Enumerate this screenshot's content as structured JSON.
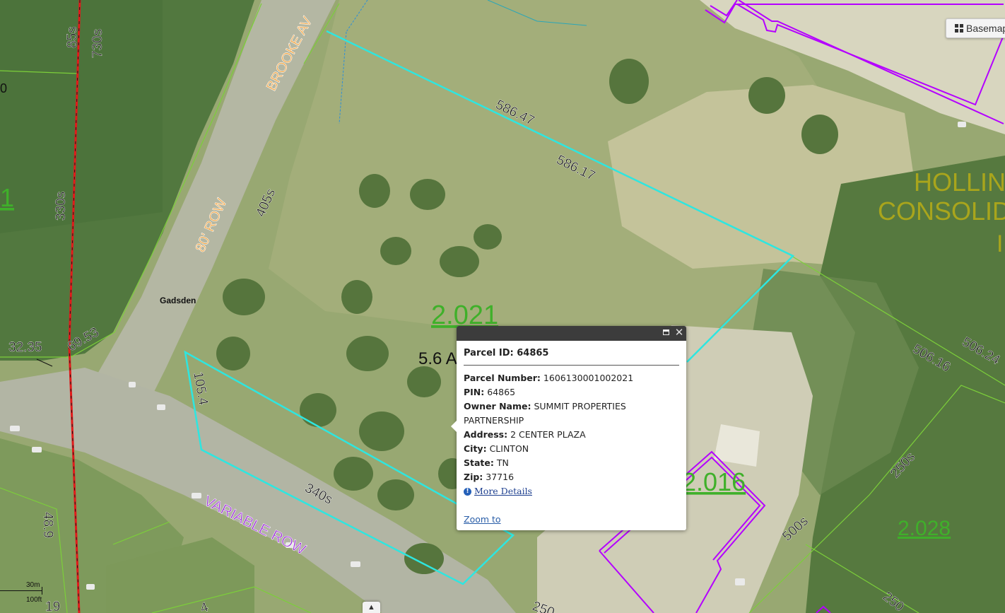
{
  "basemap": {
    "label": "Basemap",
    "icon": "grid-icon"
  },
  "map_labels": {
    "street_brooke": "BROOKE AV",
    "row_80": "80' ROW",
    "variable_row": "VARIABLE ROW",
    "gadsden": "Gadsden",
    "holling": "HOLLIN",
    "consolid": "CONSOLID",
    "edge_b": "I",
    "edge_0": "0",
    "edge_1": "1"
  },
  "parcel_labels": {
    "main": "2.021",
    "acres": "5.6 A",
    "p2016": "2.016",
    "p2028": "2.028"
  },
  "dimensions": {
    "d58647": "586.47",
    "d58617": "586.17",
    "d405s": "405s",
    "d1054": "105.4",
    "d340s": "340s",
    "d50616": "506.16",
    "d5062": "506.24",
    "d250s": "250s",
    "d500s": "500s",
    "d250": "250",
    "d250b": "250",
    "d3235": "32.35",
    "d6953": "69.53",
    "d85s": "85s",
    "d730s": "730s",
    "d330s": "330s",
    "d489": "48.9",
    "d19": "19",
    "d4": "4"
  },
  "popup": {
    "title_label": "Parcel ID:",
    "title_value": "64865",
    "fields": [
      {
        "label": "Parcel Number:",
        "value": "1606130001002021"
      },
      {
        "label": "PIN:",
        "value": "64865"
      },
      {
        "label": "Owner Name:",
        "value": "SUMMIT PROPERTIES PARTNERSHIP"
      },
      {
        "label": "Address:",
        "value": "2 CENTER PLAZA"
      },
      {
        "label": "City:",
        "value": "CLINTON"
      },
      {
        "label": "State:",
        "value": "TN"
      },
      {
        "label": "Zip:",
        "value": "37716"
      }
    ],
    "more_details": "More Details",
    "zoom_to": "Zoom to"
  },
  "scale": {
    "metric": "30m",
    "imperial": "100ft"
  },
  "colors": {
    "parcel_highlight": "#2ee6e0",
    "parcel_line": "#7ccf3a",
    "zoning": "#b400ff",
    "row_line": "#e21a1a"
  }
}
